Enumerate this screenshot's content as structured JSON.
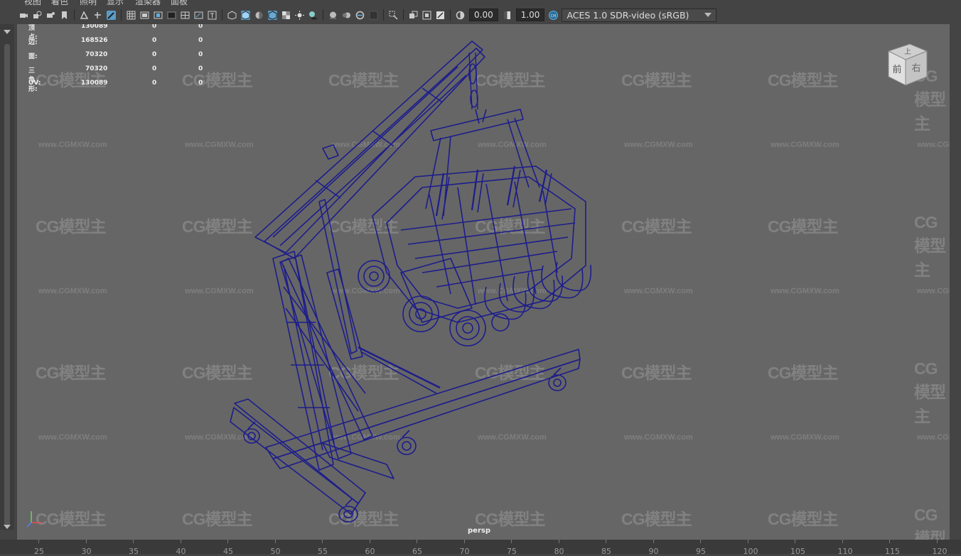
{
  "menu": {
    "items": [
      "视图",
      "着色",
      "照明",
      "显示",
      "渲染器",
      "面板"
    ]
  },
  "toolbar": {
    "exposure_value": "0.00",
    "gamma_value": "1.00",
    "color_transform": "ACES 1.0 SDR-video (sRGB)"
  },
  "hud": {
    "rows": [
      {
        "label": "顶点:",
        "value": "130089",
        "a": "0",
        "b": "0"
      },
      {
        "label": "边:",
        "value": "168526",
        "a": "0",
        "b": "0"
      },
      {
        "label": "面:",
        "value": "70320",
        "a": "0",
        "b": "0"
      },
      {
        "label": "三角形:",
        "value": "70320",
        "a": "0",
        "b": "0"
      },
      {
        "label": "UV:",
        "value": "130089",
        "a": "0",
        "b": "0"
      }
    ]
  },
  "viewcube": {
    "top": "上",
    "front": "前",
    "right": "右"
  },
  "camera_label": "persp",
  "watermark": {
    "logo": "CG模型主",
    "url": "www.CGMXW.com"
  },
  "timeline": {
    "ticks": [
      "25",
      "30",
      "35",
      "40",
      "45",
      "50",
      "55",
      "60",
      "65",
      "70",
      "75",
      "80",
      "85",
      "90",
      "95",
      "100",
      "105",
      "110",
      "115",
      "120"
    ]
  },
  "colors": {
    "viewport_bg": "#666666",
    "wireframe": "#1d1d8c",
    "ui_dark": "#444444"
  }
}
